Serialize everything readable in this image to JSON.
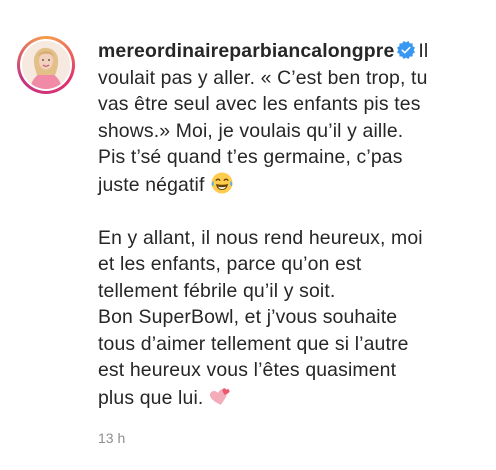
{
  "comment": {
    "username": "mereordinaireparbiancalongpre",
    "lines_p1": [
      "Il",
      "voulait pas y aller. « C’est ben trop, tu",
      "vas être seul avec les enfants pis tes",
      "shows.» Moi, je voulais qu’il y aille.",
      "Pis t’sé quand t’es germaine, c’pas",
      "juste négatif"
    ],
    "lines_p2": [
      "En y allant, il nous rend heureux, moi",
      "et les enfants, parce qu’on est",
      "tellement fébrile qu’il y soit.",
      "Bon SuperBowl, et j’vous souhaite",
      "tous d’aimer tellement que si l’autre",
      "est heureux vous l’êtes quasiment",
      "plus que lui."
    ],
    "emoji_1": "laughing-tears-emoji",
    "emoji_2": "two-hearts-emoji",
    "timestamp": "13 h"
  },
  "colors": {
    "text": "#262626",
    "muted": "#8e8e8e",
    "verified_blue": "#3897f0"
  }
}
